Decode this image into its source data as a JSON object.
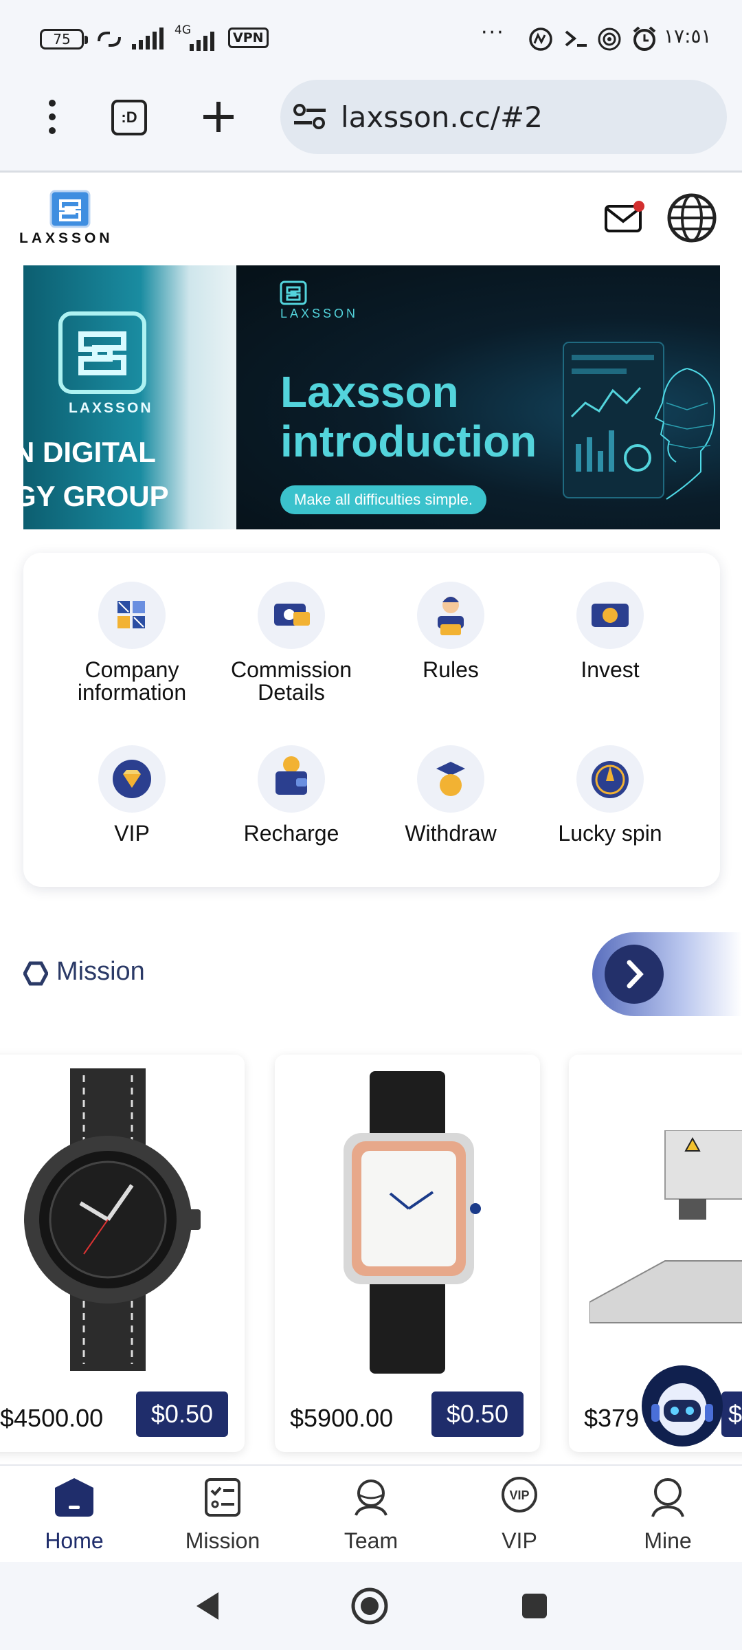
{
  "status_bar": {
    "battery": "75",
    "network": "4G",
    "vpn": "VPN",
    "time": "١٧:٥١",
    "more": "···"
  },
  "browser": {
    "url": "laxsson.cc/#2",
    "tabs_icon_label": ":D"
  },
  "header": {
    "logo_text": "LAXSSON",
    "mail_icon": "mail-icon",
    "language_icon": "globe-icon"
  },
  "banner": {
    "left_brand": "LAXSSON",
    "left_line1": "N DIGITAL",
    "left_line2": "GY GROUP",
    "right_brand": "LAXSSON",
    "title_line1": "Laxsson",
    "title_line2": "introduction",
    "tagline": "Make all difficulties simple."
  },
  "menu": {
    "items": [
      {
        "label_line1": "Company",
        "label_line2": "information",
        "icon": "grid-icon"
      },
      {
        "label_line1": "Commission",
        "label_line2": "Details",
        "icon": "wallet-card-icon"
      },
      {
        "label_line1": "Rules",
        "label_line2": "",
        "icon": "customer-service-icon"
      },
      {
        "label_line1": "Invest",
        "label_line2": "",
        "icon": "bitcoin-note-icon"
      },
      {
        "label_line1": "VIP",
        "label_line2": "",
        "icon": "diamond-icon"
      },
      {
        "label_line1": "Recharge",
        "label_line2": "",
        "icon": "wallet-icon"
      },
      {
        "label_line1": "Withdraw",
        "label_line2": "",
        "icon": "graduation-coin-icon"
      },
      {
        "label_line1": "Lucky spin",
        "label_line2": "",
        "icon": "spin-dial-icon"
      }
    ]
  },
  "mission": {
    "title": "Mission",
    "products": [
      {
        "price": "$4500.00",
        "commission": "$0.50",
        "image": "black-pilot-watch"
      },
      {
        "price": "$5900.00",
        "commission": "$0.50",
        "image": "square-gold-watch"
      },
      {
        "price": "$379",
        "commission": "$",
        "image": "laser-machine"
      }
    ]
  },
  "bottom_nav": {
    "items": [
      {
        "label": "Home",
        "active": true
      },
      {
        "label": "Mission",
        "active": false
      },
      {
        "label": "Team",
        "active": false
      },
      {
        "label": "VIP",
        "active": false
      },
      {
        "label": "Mine",
        "active": false
      }
    ]
  },
  "colors": {
    "primary": "#1f2d6b",
    "banner_accent": "#53d4dc",
    "page_bg": "#ffffff"
  }
}
